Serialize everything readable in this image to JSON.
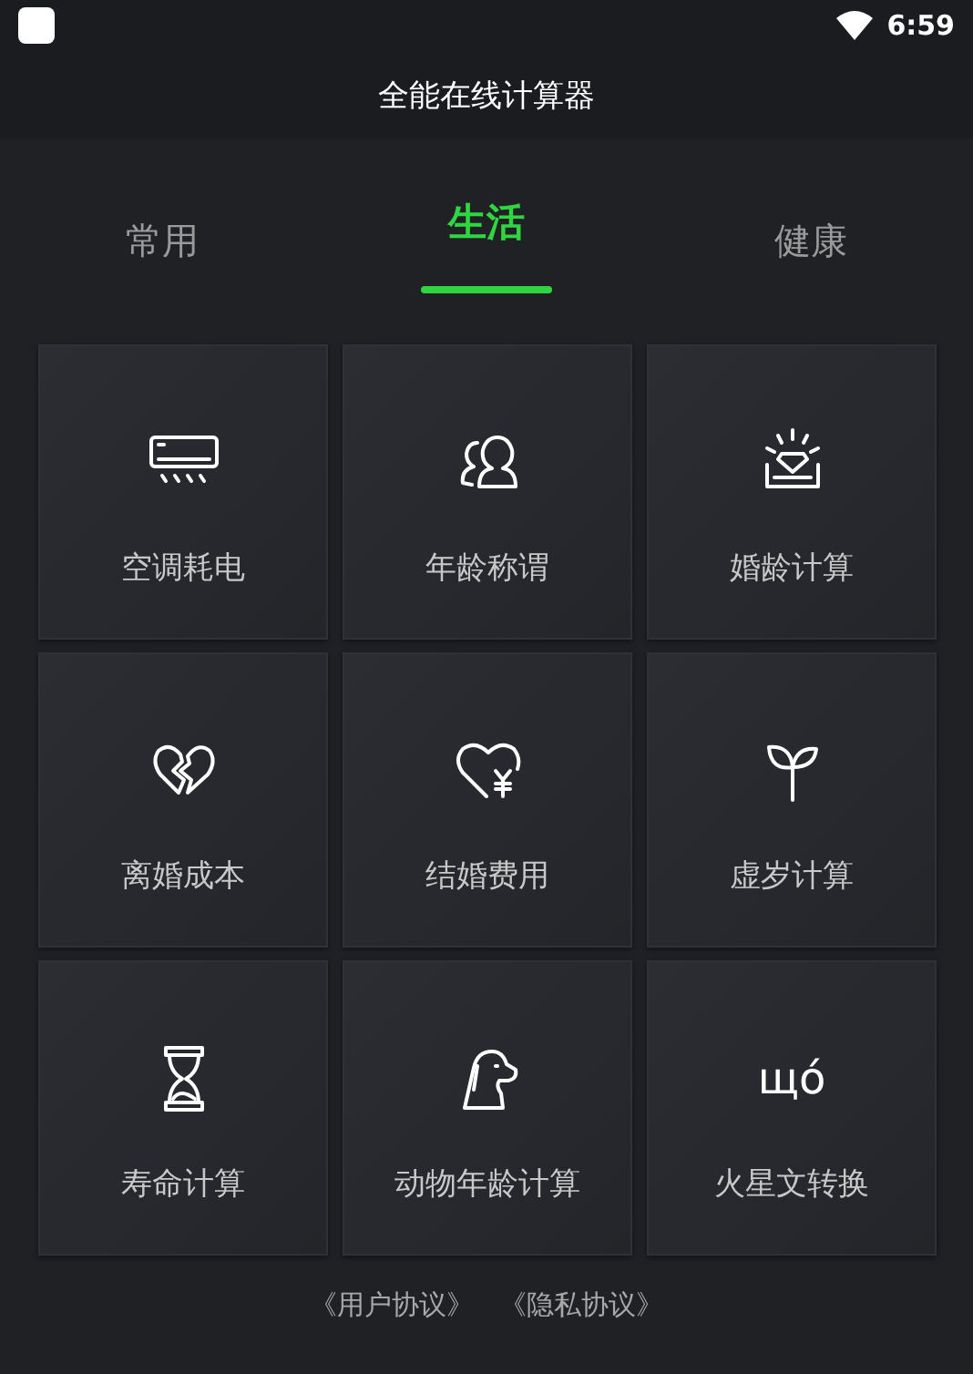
{
  "status_bar": {
    "time": "6:59"
  },
  "window": {
    "title": "全能在线计算器"
  },
  "tabs": [
    {
      "label": "常用",
      "selected": false
    },
    {
      "label": "生活",
      "selected": true
    },
    {
      "label": "健康",
      "selected": false
    }
  ],
  "tool_rows": [
    [
      {
        "label": "空调耗电",
        "kind": "air-conditioner"
      },
      {
        "label": "年龄称谓",
        "kind": "people"
      },
      {
        "label": "婚龄计算",
        "kind": "diamond"
      }
    ],
    [
      {
        "label": "离婚成本",
        "kind": "broken-heart"
      },
      {
        "label": "结婚费用",
        "kind": "heart-yen"
      },
      {
        "label": "虚岁计算",
        "kind": "sprout"
      }
    ],
    [
      {
        "label": "寿命计算",
        "kind": "hourglass"
      },
      {
        "label": "动物年龄计算",
        "kind": "dog"
      },
      {
        "kind": "glyph",
        "glyph": "щó",
        "label": "火星文转换"
      }
    ]
  ],
  "footer_links": [
    "《用户协议》",
    "《隐私协议》"
  ]
}
